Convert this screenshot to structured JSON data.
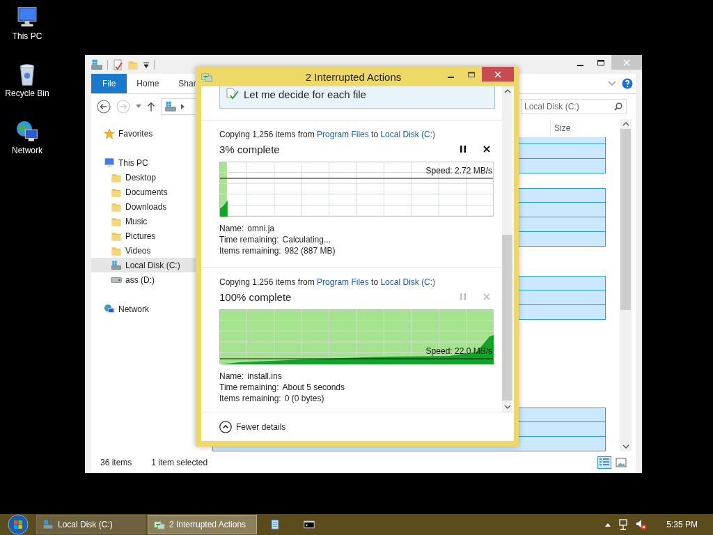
{
  "desktop_icons": [
    {
      "kind": "pc",
      "label": "This PC"
    },
    {
      "kind": "bin",
      "label": "Recycle Bin"
    },
    {
      "kind": "network",
      "label": "Network"
    }
  ],
  "explorer": {
    "ribbon_tabs": [
      {
        "label": "File",
        "selected": true
      },
      {
        "label": "Home",
        "selected": false
      },
      {
        "label": "Shar",
        "selected": false
      }
    ],
    "search": {
      "placeholder": "Local Disk (C:)"
    },
    "columns": [
      {
        "label": "Size"
      }
    ],
    "nav": [
      {
        "kind": "star",
        "label": "Favorites",
        "selected": false
      },
      {
        "kind": "pc",
        "label": "This PC",
        "selected": false,
        "children": [
          {
            "kind": "folder",
            "label": "Desktop",
            "selected": false
          },
          {
            "kind": "folder",
            "label": "Documents",
            "selected": false
          },
          {
            "kind": "folder",
            "label": "Downloads",
            "selected": false
          },
          {
            "kind": "folder",
            "label": "Music",
            "selected": false
          },
          {
            "kind": "folder",
            "label": "Pictures",
            "selected": false
          },
          {
            "kind": "folder",
            "label": "Videos",
            "selected": false
          },
          {
            "kind": "drive",
            "label": "Local Disk (C:)",
            "selected": true
          },
          {
            "kind": "disk",
            "label": "ass (D:)",
            "selected": false
          }
        ]
      },
      {
        "kind": "network",
        "label": "Network",
        "selected": false
      }
    ],
    "rows": [
      {
        "selected": true
      },
      {
        "selected": true
      },
      {
        "selected": true
      },
      {
        "selected": false
      },
      {
        "selected": true
      },
      {
        "selected": true
      },
      {
        "selected": true
      },
      {
        "selected": true
      },
      {
        "selected": false
      },
      {
        "selected": false
      },
      {
        "selected": true
      },
      {
        "selected": true
      },
      {
        "selected": true
      },
      {
        "selected": false
      },
      {
        "selected": false
      },
      {
        "selected": false
      },
      {
        "selected": false
      },
      {
        "selected": false
      },
      {
        "selected": false
      },
      {
        "selected": true
      },
      {
        "selected": true
      },
      {
        "selected": true
      }
    ],
    "status_bar": {
      "count": "36 items",
      "selection": "1 item selected"
    }
  },
  "dialog": {
    "title": "2 Interrupted Actions",
    "choice": "Let me decide for each file",
    "operations": [
      {
        "text_before": "Copying 1,256 items from",
        "source": "Program Files",
        "text_between": "to",
        "destination": "Local Disk (C:)",
        "percent": "3% complete",
        "controls_disabled": false,
        "level": 0.03,
        "speed": "Speed: 2.72 MB/s",
        "details": [
          {
            "label": "Name:",
            "value": "omni.ja"
          },
          {
            "label": "Time remaining:",
            "value": "Calculating..."
          },
          {
            "label": "Items remaining:",
            "value": "982 (887 MB)"
          }
        ]
      },
      {
        "text_before": "Copying 1,256 items from",
        "source": "Program Files",
        "text_between": "to",
        "destination": "Local Disk (C:)",
        "percent": "100% complete",
        "controls_disabled": true,
        "level": 1,
        "speed": "Speed: 22.0 MB/s",
        "details": [
          {
            "label": "Name:",
            "value": "install.ins"
          },
          {
            "label": "Time remaining:",
            "value": "About 5 seconds"
          },
          {
            "label": "Items remaining:",
            "value": "0 (0 bytes)"
          }
        ]
      }
    ],
    "toggle": "Fewer details"
  },
  "taskbar": {
    "items": [
      {
        "kind": "explorer",
        "label": "Local Disk (C:)",
        "selected": false
      },
      {
        "kind": "copy",
        "label": "2 Interrupted Actions",
        "selected": true
      },
      {
        "kind": "notepad",
        "selected": false
      },
      {
        "kind": "cmd",
        "selected": false
      }
    ],
    "clock": "5:35 PM"
  }
}
